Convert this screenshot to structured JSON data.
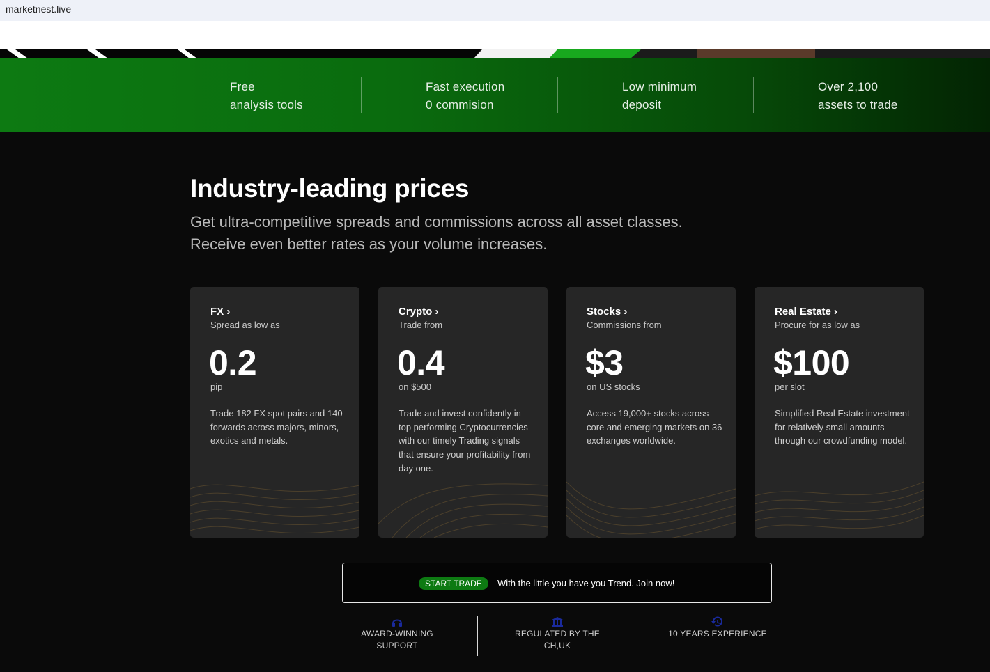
{
  "browser": {
    "url": "marketnest.live"
  },
  "features": [
    {
      "line1": "Free",
      "line2": "analysis tools"
    },
    {
      "line1": "Fast execution",
      "line2": "0 commision"
    },
    {
      "line1": "Low minimum",
      "line2": "deposit"
    },
    {
      "line1": "Over 2,100",
      "line2": "assets to trade"
    }
  ],
  "prices": {
    "title": "Industry-leading prices",
    "subtitle": "Get ultra-competitive spreads and commissions across all asset classes. Receive even better rates as your volume increases."
  },
  "cards": [
    {
      "title": "FX",
      "sub": "Spread as low as",
      "value": "0.2",
      "unit": "pip",
      "desc": "Trade 182 FX spot pairs and 140 forwards across majors, minors, exotics and metals."
    },
    {
      "title": "Crypto",
      "sub": "Trade from",
      "value": "0.4",
      "unit": "on $500",
      "desc": "Trade and invest confidently in top performing Cryptocurrencies with our timely Trading signals that ensure your profitability from day one."
    },
    {
      "title": "Stocks",
      "sub": "Commissions from",
      "value": "$3",
      "unit": "on US stocks",
      "desc": "Access 19,000+ stocks across core and emerging markets on 36 exchanges worldwide."
    },
    {
      "title": "Real Estate",
      "sub": "Procure for as low as",
      "value": "$100",
      "unit": "per slot",
      "desc": "Simplified Real Estate investment for relatively small amounts through our crowdfunding model."
    }
  ],
  "cta": {
    "badge": "START TRADE",
    "text": "With the little you have you Trend. Join now!"
  },
  "trust": [
    {
      "icon": "headset-icon",
      "line1": "AWARD-WINNING",
      "line2": "SUPPORT"
    },
    {
      "icon": "bank-icon",
      "line1": "REGULATED BY THE",
      "line2": "CH,UK"
    },
    {
      "icon": "history-icon",
      "line1": "10 YEARS EXPERIENCE",
      "line2": ""
    }
  ],
  "colors": {
    "accent_green": "#0d7a12",
    "background": "#0a0a0a",
    "card": "#262626",
    "icon_blue": "#1a2a9c"
  }
}
